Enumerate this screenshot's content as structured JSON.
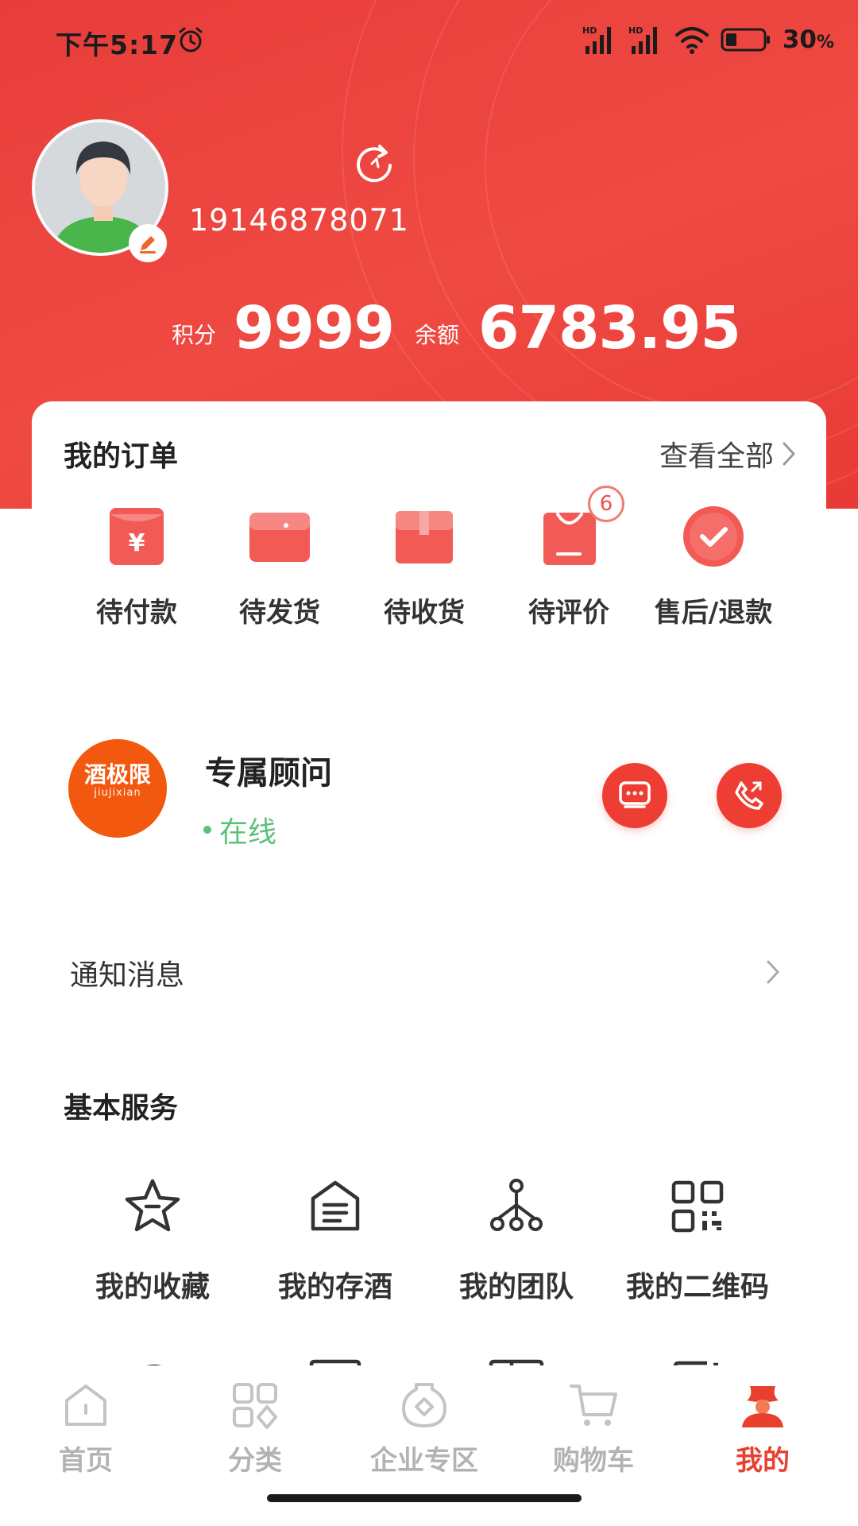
{
  "status_bar": {
    "time": "下午5:17",
    "battery_percent": "30",
    "battery_unit": "%",
    "battery_level": 0.3
  },
  "profile": {
    "phone": "19146878071",
    "points_label": "积分",
    "points_value": "9999",
    "balance_label": "余额",
    "balance_value": "6783.95"
  },
  "orders": {
    "title": "我的订单",
    "view_all": "查看全部",
    "items": [
      {
        "label": "待付款",
        "icon": "pending-payment-icon",
        "badge": ""
      },
      {
        "label": "待发货",
        "icon": "pending-shipment-icon",
        "badge": ""
      },
      {
        "label": "待收货",
        "icon": "pending-receipt-icon",
        "badge": ""
      },
      {
        "label": "待评价",
        "icon": "pending-review-icon",
        "badge": "6"
      },
      {
        "label": "售后/退款",
        "icon": "after-sales-icon",
        "badge": ""
      }
    ]
  },
  "advisor": {
    "logo_text": "酒极限",
    "logo_sub": "jiujixian",
    "title": "专属顾问",
    "status": "在线"
  },
  "notice": {
    "label": "通知消息"
  },
  "services": {
    "title": "基本服务",
    "items": [
      {
        "label": "我的收藏",
        "icon": "star-icon"
      },
      {
        "label": "我的存酒",
        "icon": "wine-storage-icon"
      },
      {
        "label": "我的团队",
        "icon": "team-icon"
      },
      {
        "label": "我的二维码",
        "icon": "qr-code-icon"
      }
    ]
  },
  "tabbar": {
    "tabs": [
      {
        "label": "首页",
        "icon": "home-icon",
        "active": false
      },
      {
        "label": "分类",
        "icon": "category-icon",
        "active": false
      },
      {
        "label": "企业专区",
        "icon": "enterprise-icon",
        "active": false
      },
      {
        "label": "购物车",
        "icon": "cart-icon",
        "active": false
      },
      {
        "label": "我的",
        "icon": "profile-icon",
        "active": true
      }
    ]
  },
  "colors": {
    "primary": "#e8402f",
    "header": "#ee4840",
    "online": "#5cc07d",
    "inactive_tab": "#b3b3b3"
  }
}
